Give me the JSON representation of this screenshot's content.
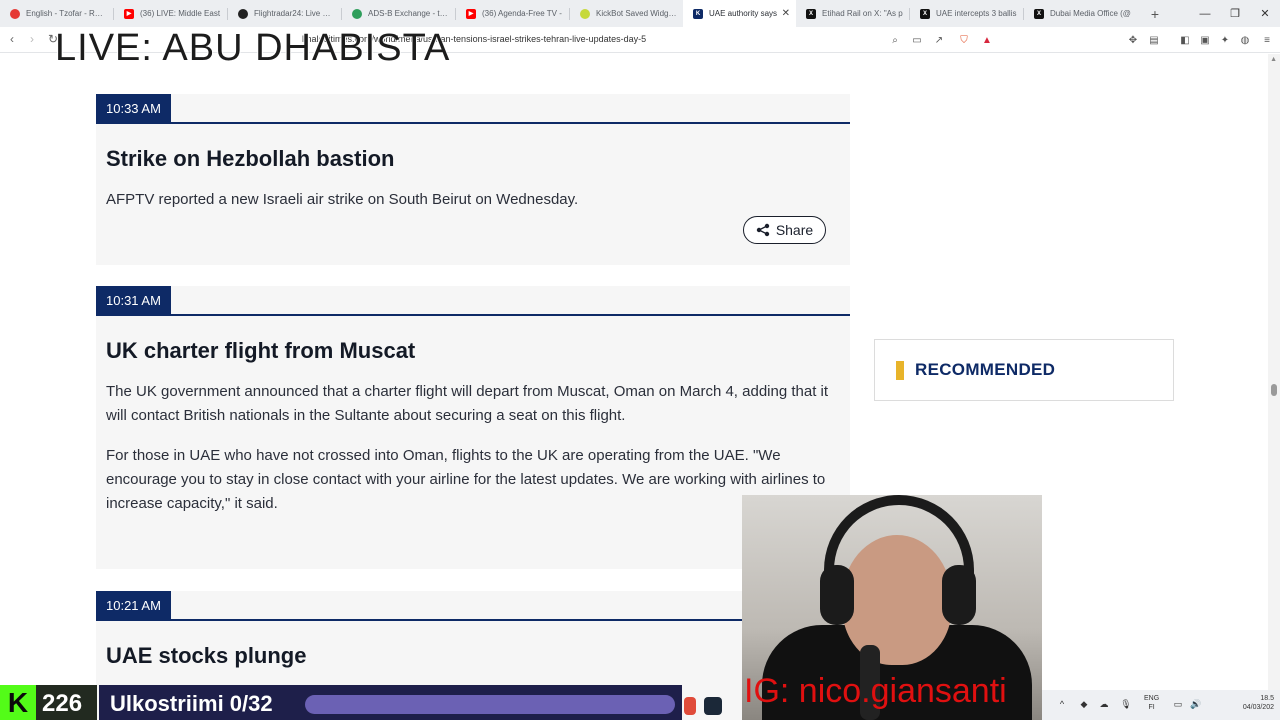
{
  "browser": {
    "tabs": [
      {
        "title": "English - Tzofar - Red Alert",
        "color": "#e53935",
        "active": false
      },
      {
        "title": "(36) LIVE: Middle East",
        "color": "#ff0000",
        "active": false
      },
      {
        "title": "Flightradar24: Live Flight",
        "color": "#222222",
        "active": false
      },
      {
        "title": "ADS-B Exchange - track",
        "color": "#2e9e5b",
        "active": false
      },
      {
        "title": "(36) Agenda-Free TV -",
        "color": "#ff0000",
        "active": false
      },
      {
        "title": "KickBot Saved Widgets",
        "color": "#c6d93a",
        "active": false
      },
      {
        "title": "UAE authority says",
        "color": "#0e2a66",
        "active": true
      },
      {
        "title": "Etihad Rail on X: \"As p",
        "color": "#111111",
        "active": false
      },
      {
        "title": "UAE intercepts 3 ballis",
        "color": "#111111",
        "active": false
      },
      {
        "title": "Dubai Media Office (@",
        "color": "#111111",
        "active": false
      }
    ],
    "url": "khaleejtimes.com/world/mena/us-iran-tensions-israel-strikes-tehran-live-updates-day-5"
  },
  "overlay": {
    "live_title": "LIVE: ABU DHABISTA",
    "ig_handle": "IG: nico.giansanti",
    "counter": "226",
    "kick_logo": "K",
    "stream_label": "Ulkostriimi 0/32",
    "stream_progress": 0
  },
  "feed": {
    "share_label": "Share",
    "entries": [
      {
        "time": "10:33 AM",
        "title": "Strike on Hezbollah bastion",
        "paragraphs": [
          "AFPTV reported a new Israeli air strike on South Beirut on Wednesday."
        ]
      },
      {
        "time": "10:31 AM",
        "title": "UK charter flight from Muscat",
        "paragraphs": [
          "The UK government announced that a charter flight will depart from Muscat, Oman on March 4, adding that it will contact British nationals in the Sultante about securing a seat on this flight.",
          "For those in UAE who have not crossed into Oman, flights to the UK are operating from the UAE. \"We encourage you to stay in close contact with your airline for the latest updates. We are working with airlines to increase capacity,\" it said."
        ]
      },
      {
        "time": "10:21 AM",
        "title": "UAE stocks plunge",
        "paragraphs": []
      }
    ]
  },
  "sidebar": {
    "recommended_label": "RECOMMENDED"
  },
  "taskbar": {
    "lang_1": "ENG",
    "lang_2": "FI",
    "time": "18.5",
    "date": "04/03/202"
  },
  "colors": {
    "navy": "#0e2a66",
    "accent_yellow": "#e8b42a",
    "kick_green": "#53fc18",
    "overlay_red": "#e01010"
  }
}
